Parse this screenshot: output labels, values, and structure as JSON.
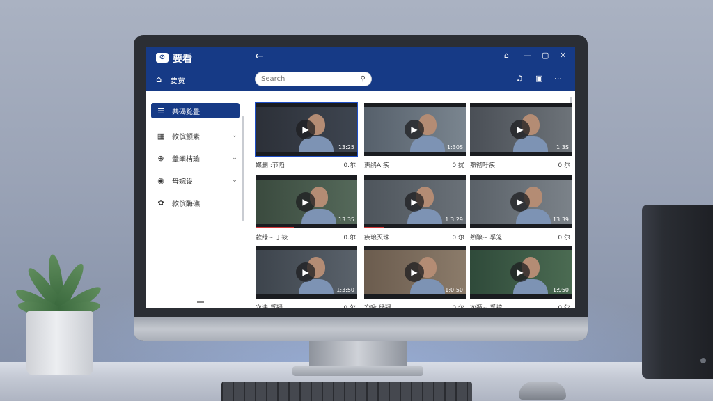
{
  "app": {
    "title": "要看",
    "logo_glyph": "⊘"
  },
  "sidebar": {
    "home_label": "要贾",
    "items": [
      {
        "label": "共碣覧畳",
        "icon": "list-icon",
        "active": true,
        "chevron": false
      },
      {
        "label": "款傧颤素",
        "icon": "grid-icon",
        "active": false,
        "chevron": true
      },
      {
        "label": "羹阐桔瑜",
        "icon": "pin-icon",
        "active": false,
        "chevron": true
      },
      {
        "label": "母婉设",
        "icon": "globe-icon",
        "active": false,
        "chevron": true
      },
      {
        "label": "款傧酶礁",
        "icon": "gear-icon",
        "active": false,
        "chevron": false
      }
    ]
  },
  "search": {
    "placeholder": "Search"
  },
  "videos": [
    {
      "title": "媒删 :节陷",
      "views": "0.尔",
      "duration": "13:25",
      "selected": true,
      "progress": 0
    },
    {
      "title": "熏鹃A:疾",
      "views": "0.扰",
      "duration": "1:30S",
      "selected": false,
      "progress": 0
    },
    {
      "title": "熟彻吁疾",
      "views": "0.尔",
      "duration": "1:3S",
      "selected": false,
      "progress": 0
    },
    {
      "title": "款绿~ 丁筱",
      "views": "0.尔",
      "duration": "13:35",
      "selected": false,
      "progress": 0.38
    },
    {
      "title": "疾琅灭珠",
      "views": "0.尔",
      "duration": "1:3:29",
      "selected": false,
      "progress": 0.2
    },
    {
      "title": "熟酿~ 孚笼",
      "views": "0.尔",
      "duration": "13:39",
      "selected": false,
      "progress": 0
    },
    {
      "title": "次迭 孚疑",
      "views": "0.尔",
      "duration": "1:3:50",
      "selected": false,
      "progress": 0
    },
    {
      "title": "次咏 纾疑",
      "views": "0.尔",
      "duration": "1:0:50",
      "selected": false,
      "progress": 0
    },
    {
      "title": "次遁~ 孚挖",
      "views": "0.尔",
      "duration": "1:950",
      "selected": false,
      "progress": 0
    }
  ],
  "colors": {
    "brand": "#163a86",
    "selected_outline": "#1f4fc6",
    "progress": "#d23a3a"
  }
}
